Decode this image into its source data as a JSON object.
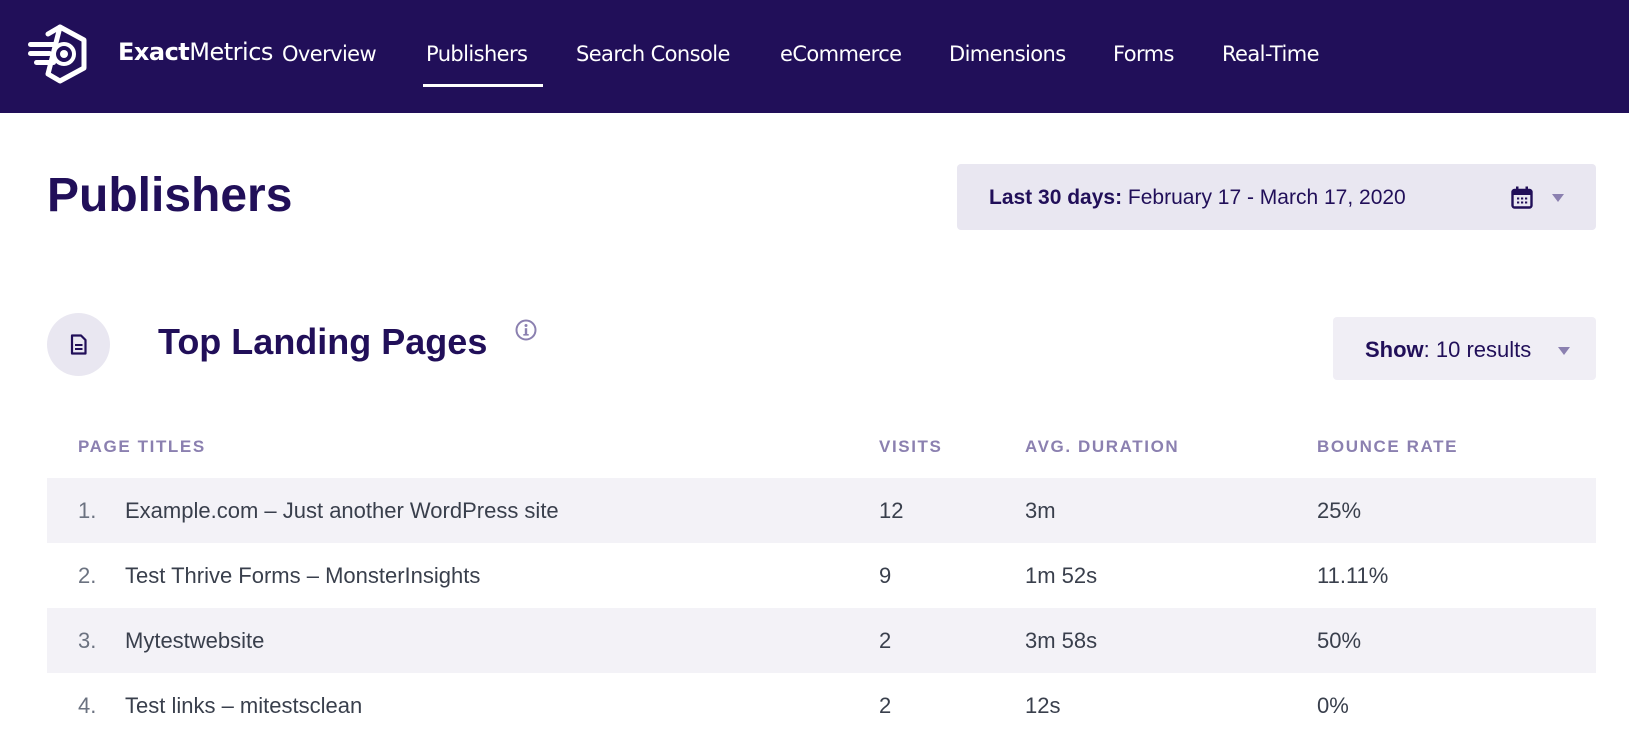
{
  "header": {
    "brand_bold": "Exact",
    "brand_light": "Metrics",
    "logo_icon": "exactmetrics-logo-icon",
    "nav": [
      {
        "label": "Overview",
        "active": false
      },
      {
        "label": "Publishers",
        "active": true
      },
      {
        "label": "Search Console",
        "active": false
      },
      {
        "label": "eCommerce",
        "active": false
      },
      {
        "label": "Dimensions",
        "active": false
      },
      {
        "label": "Forms",
        "active": false
      },
      {
        "label": "Real-Time",
        "active": false
      }
    ]
  },
  "page": {
    "title": "Publishers",
    "date_range": {
      "prefix": "Last 30 days:",
      "value": "February 17 - March 17, 2020",
      "icon": "calendar-icon"
    }
  },
  "section": {
    "icon": "document-icon",
    "title": "Top Landing Pages",
    "info_icon": "info-icon",
    "show": {
      "prefix": "Show",
      "value": ": 10 results"
    }
  },
  "table": {
    "columns": [
      "PAGE TITLES",
      "VISITS",
      "AVG. DURATION",
      "BOUNCE RATE"
    ],
    "rows": [
      {
        "num": "1.",
        "title": "Example.com – Just another WordPress site",
        "visits": "12",
        "duration": "3m",
        "bounce": "25%"
      },
      {
        "num": "2.",
        "title": "Test Thrive Forms – MonsterInsights",
        "visits": "9",
        "duration": "1m 52s",
        "bounce": "11.11%"
      },
      {
        "num": "3.",
        "title": "Mytestwebsite",
        "visits": "2",
        "duration": "3m 58s",
        "bounce": "50%"
      },
      {
        "num": "4.",
        "title": "Test links – mitestsclean",
        "visits": "2",
        "duration": "12s",
        "bounce": "0%"
      }
    ]
  },
  "colors": {
    "brand_dark": "#210f59",
    "muted_purple": "#8b80b0",
    "panel_bg": "#e9e7f1",
    "row_alt_bg": "#f3f2f7"
  }
}
